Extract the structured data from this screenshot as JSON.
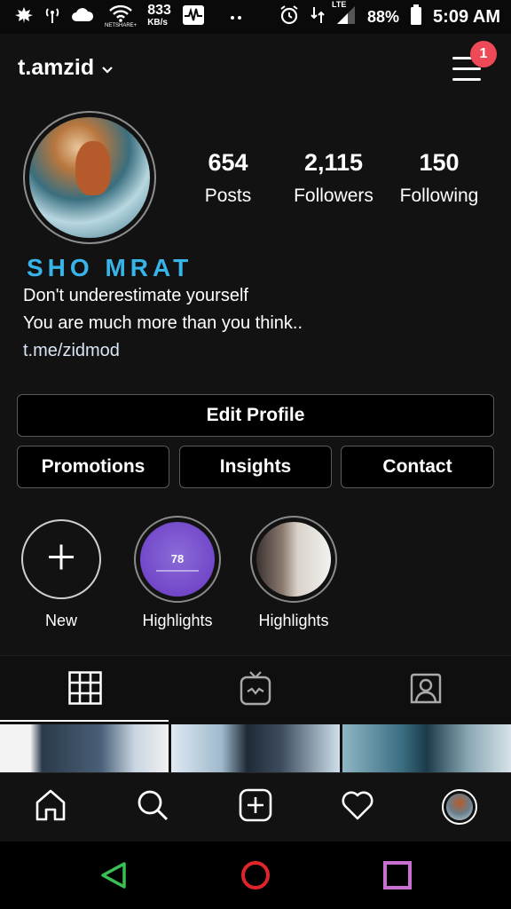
{
  "status_bar": {
    "net_speed_value": "833",
    "net_speed_unit": "KB/s",
    "carrier_label": "NETSHARE+",
    "network_type": "LTE",
    "battery": "88%",
    "time": "5:09 AM",
    "icons": [
      "leaf-icon",
      "signal-tower-icon",
      "cloud-icon",
      "wifi-icon",
      "activity-icon",
      "dots-icon",
      "alarm-icon",
      "data-arrows-icon",
      "cell-signal-icon",
      "battery-icon"
    ]
  },
  "header": {
    "username": "t.amzid",
    "notification_count": "1"
  },
  "profile": {
    "display_name": "SHO MRAT",
    "bio_line1": "Don't underestimate yourself",
    "bio_line2": "You are much more than you think..",
    "link": "t.me/zidmod"
  },
  "stats": [
    {
      "value": "654",
      "label": "Posts"
    },
    {
      "value": "2,115",
      "label": "Followers"
    },
    {
      "value": "150",
      "label": "Following"
    }
  ],
  "buttons": {
    "edit_profile": "Edit Profile",
    "promotions": "Promotions",
    "insights": "Insights",
    "contact": "Contact"
  },
  "stories": [
    {
      "label": "New"
    },
    {
      "label": "Highlights",
      "inner_value": "78"
    },
    {
      "label": "Highlights"
    }
  ],
  "tabs": [
    "grid-icon",
    "igtv-icon",
    "tagged-icon"
  ],
  "bottom_nav": [
    "home-icon",
    "search-icon",
    "add-post-icon",
    "heart-icon",
    "profile-avatar"
  ],
  "colors": {
    "accent_name": "#37b4e8",
    "badge": "#ed4956",
    "android_back": "#3bbf54",
    "android_home": "#e0242c",
    "android_recents": "#c86fd1"
  }
}
